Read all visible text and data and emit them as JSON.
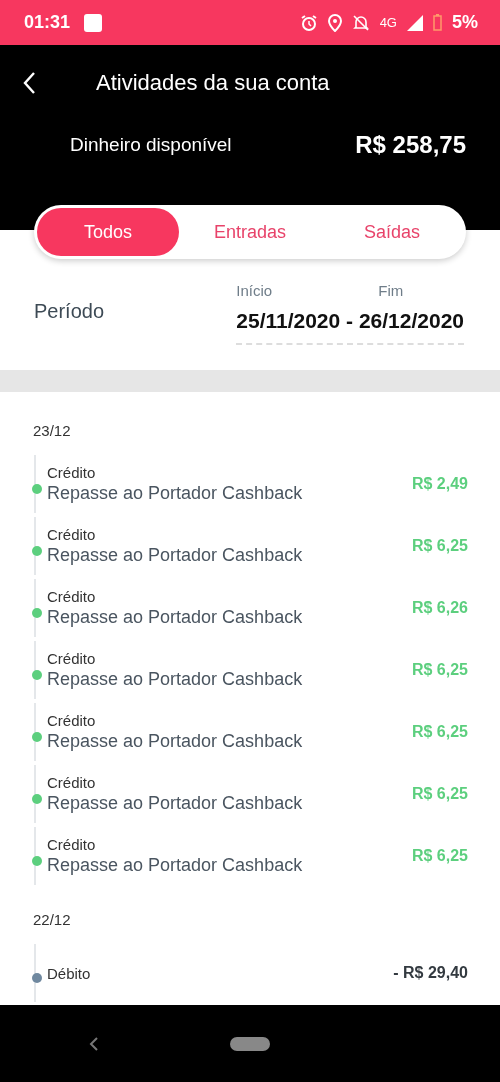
{
  "status_bar": {
    "time": "01:31",
    "battery": "5%",
    "network": "4G"
  },
  "header": {
    "title": "Atividades da sua conta",
    "balance_label": "Dinheiro disponível",
    "balance": "R$ 258,75"
  },
  "tabs": [
    {
      "label": "Todos",
      "selected": true
    },
    {
      "label": "Entradas",
      "selected": false
    },
    {
      "label": "Saídas",
      "selected": false
    }
  ],
  "period": {
    "label": "Período",
    "start_label": "Início",
    "end_label": "Fim",
    "range": "25/11/2020 - 26/12/2020"
  },
  "groups": [
    {
      "date": "23/12",
      "items": [
        {
          "kind": "credit",
          "type": "Crédito",
          "description": "Repasse ao Portador Cashback",
          "amount": "R$ 2,49"
        },
        {
          "kind": "credit",
          "type": "Crédito",
          "description": "Repasse ao Portador Cashback",
          "amount": "R$ 6,25"
        },
        {
          "kind": "credit",
          "type": "Crédito",
          "description": "Repasse ao Portador Cashback",
          "amount": "R$ 6,26"
        },
        {
          "kind": "credit",
          "type": "Crédito",
          "description": "Repasse ao Portador Cashback",
          "amount": "R$ 6,25"
        },
        {
          "kind": "credit",
          "type": "Crédito",
          "description": "Repasse ao Portador Cashback",
          "amount": "R$ 6,25"
        },
        {
          "kind": "credit",
          "type": "Crédito",
          "description": "Repasse ao Portador Cashback",
          "amount": "R$ 6,25"
        },
        {
          "kind": "credit",
          "type": "Crédito",
          "description": "Repasse ao Portador Cashback",
          "amount": "R$ 6,25"
        }
      ]
    },
    {
      "date": "22/12",
      "items": [
        {
          "kind": "debit",
          "type": "Débito",
          "amount": "- R$ 29,40"
        }
      ]
    }
  ]
}
